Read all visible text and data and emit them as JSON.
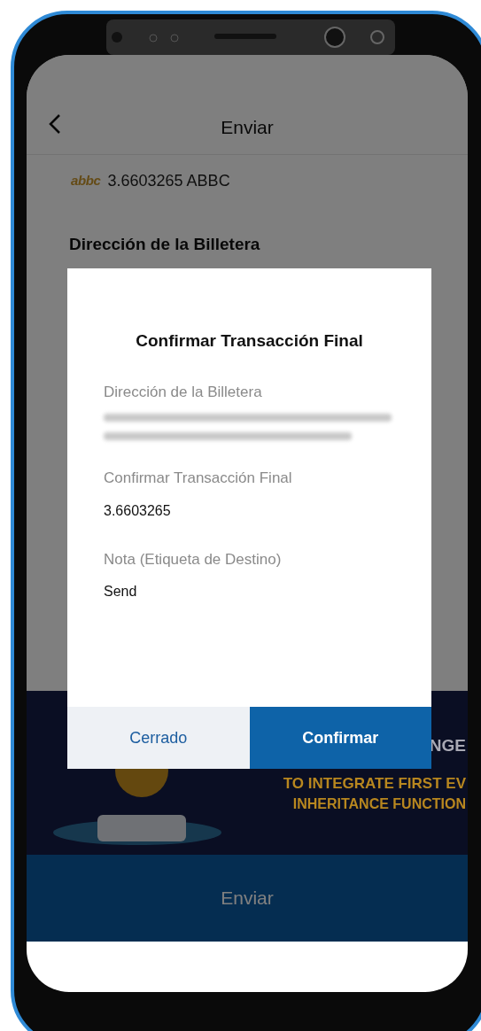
{
  "header": {
    "title": "Enviar"
  },
  "balance": {
    "logo_text": "abbc",
    "amount": "3.6603265 ABBC"
  },
  "wallet_label": "Dirección de la Billetera",
  "banner": {
    "lines": [
      "NGE",
      "TO INTEGRATE FIRST EV",
      "INHERITANCE FUNCTION"
    ]
  },
  "send_button": {
    "label": "Enviar"
  },
  "dialog": {
    "title": "Confirmar Transacción Final",
    "fields": [
      {
        "kind": "blurred",
        "label": "Dirección de la Billetera"
      },
      {
        "kind": "text",
        "label": "Confirmar Transacción Final",
        "value": "3.6603265"
      },
      {
        "kind": "text",
        "label": "Nota (Etiqueta de Destino)",
        "value": "Send"
      }
    ],
    "buttons": [
      {
        "kind": "secondary",
        "label": "Cerrado"
      },
      {
        "kind": "primary",
        "label": "Confirmar"
      }
    ]
  }
}
